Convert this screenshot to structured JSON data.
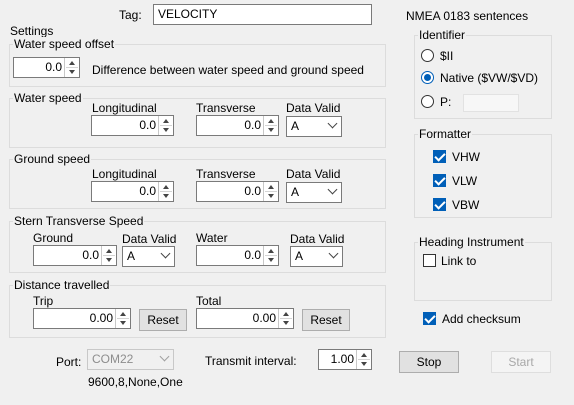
{
  "tag": {
    "label": "Tag:",
    "value": "VELOCITY"
  },
  "settings": {
    "title": "Settings",
    "water_speed_offset": {
      "title": "Water speed offset",
      "value": "0.0",
      "description": "Difference between water speed and ground speed"
    },
    "water_speed": {
      "title": "Water speed",
      "longitudinal_label": "Longitudinal",
      "longitudinal": "0.0",
      "transverse_label": "Transverse",
      "transverse": "0.0",
      "valid_label": "Data Valid",
      "valid": "A"
    },
    "ground_speed": {
      "title": "Ground speed",
      "longitudinal_label": "Longitudinal",
      "longitudinal": "0.0",
      "transverse_label": "Transverse",
      "transverse": "0.0",
      "valid_label": "Data Valid",
      "valid": "A"
    },
    "stern": {
      "title": "Stern Transverse Speed",
      "ground_label": "Ground",
      "ground": "0.0",
      "ground_valid_label": "Data Valid",
      "ground_valid": "A",
      "water_label": "Water",
      "water": "0.0",
      "water_valid_label": "Data Valid",
      "water_valid": "A"
    },
    "distance": {
      "title": "Distance travelled",
      "trip_label": "Trip",
      "trip": "0.00",
      "trip_reset": "Reset",
      "total_label": "Total",
      "total": "0.00",
      "total_reset": "Reset"
    }
  },
  "nmea": {
    "title": "NMEA 0183 sentences",
    "identifier": {
      "title": "Identifier",
      "options": [
        "$II",
        "Native ($VW/$VD)",
        "P:"
      ],
      "selected": "Native ($VW/$VD)",
      "p_value": ""
    },
    "formatter": {
      "title": "Formatter",
      "items": [
        {
          "label": "VHW",
          "checked": true
        },
        {
          "label": "VLW",
          "checked": true
        },
        {
          "label": "VBW",
          "checked": true
        }
      ]
    },
    "heading": {
      "title": "Heading Instrument",
      "link_label": "Link to",
      "link_checked": false
    },
    "checksum": {
      "label": "Add checksum",
      "checked": true
    }
  },
  "footer": {
    "port_label": "Port:",
    "port": "COM22",
    "port_settings": "9600,8,None,One",
    "interval_label": "Transmit interval:",
    "interval": "1.00",
    "stop": "Stop",
    "start": "Start"
  },
  "colors": {
    "accent": "#005fb8",
    "background": "#f0f0f0"
  }
}
